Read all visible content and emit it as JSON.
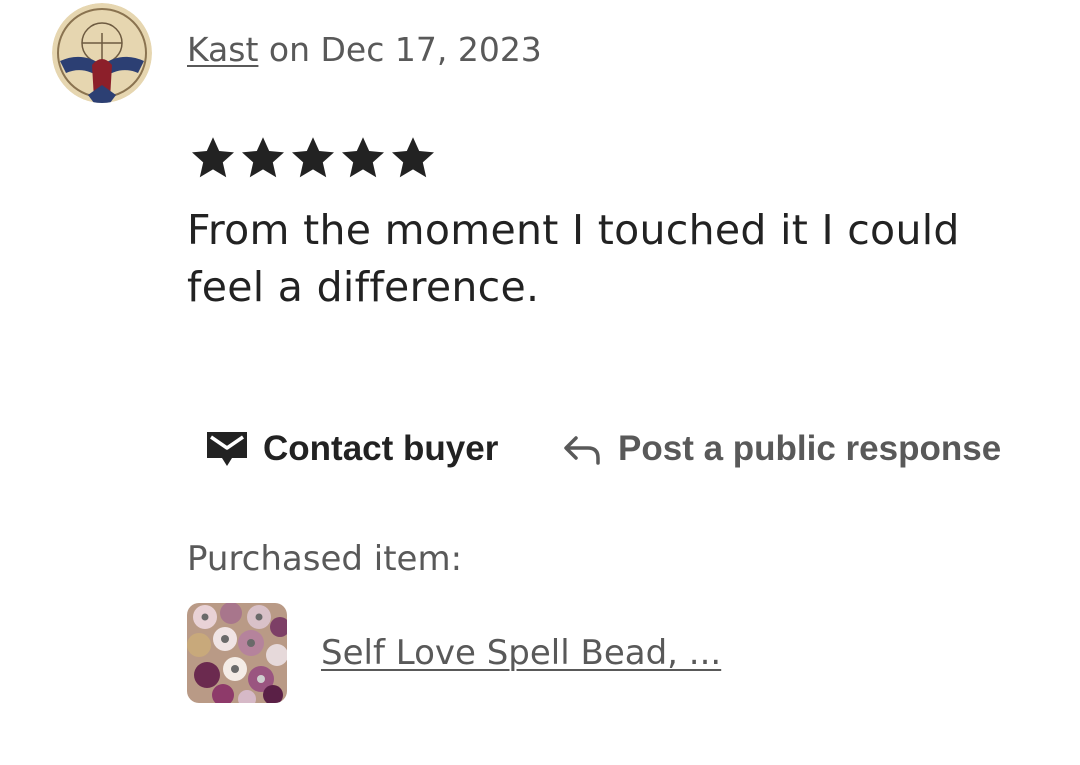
{
  "review": {
    "author": "Kast",
    "date_text": " on Dec 17, 2023",
    "rating": 5,
    "rating_max": 5,
    "text": "From the moment I touched it I could feel a difference."
  },
  "actions": {
    "contact_label": "Contact buyer",
    "respond_label": "Post a public response"
  },
  "purchase": {
    "label": "Purchased item:",
    "item_title": "Self Love Spell Bead, ..."
  },
  "colors": {
    "primary_text": "#222222",
    "secondary_text": "#595959",
    "background": "#ffffff"
  },
  "icons": {
    "star": "star-icon",
    "contact": "envelope-icon",
    "respond": "reply-arrow-icon"
  }
}
